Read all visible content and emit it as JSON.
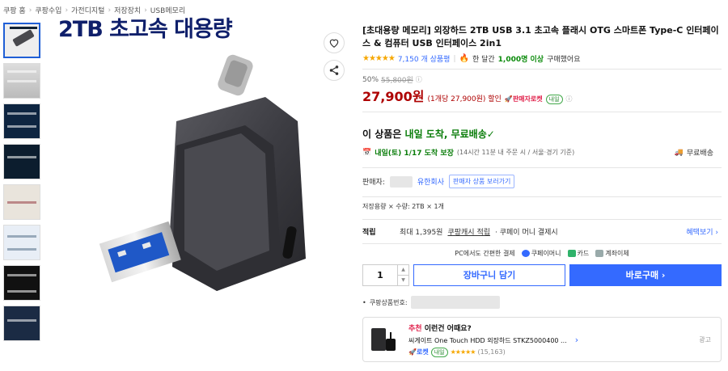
{
  "breadcrumb": [
    "쿠팡 홈",
    "쿠팡수입",
    "가전디지털",
    "저장장치",
    "USB메모리"
  ],
  "gallery": {
    "main_title": "2TB 초고속 대용량"
  },
  "product": {
    "title": "[초대용량 메모리] 외장하드 2TB USB 3.1 초고속 플래시 OTG 스마트폰 Type-C 인터페이스 & 컴퓨터 USB 인터페이스 2in1",
    "stars": "★★★★★",
    "review_count": "7,150 개 상품평",
    "buyers_prefix": "한 달간",
    "buyers_count": "1,000명 이상",
    "buyers_suffix": "구매했어요"
  },
  "price": {
    "discount_pct": "50%",
    "original_price": "55,800원",
    "sale_price": "27,900원",
    "unit_price": "(1개당 27,900원) 할인",
    "rocket_label": "판매자로켓",
    "rocket_tag": "내일"
  },
  "delivery": {
    "headline_prefix": "이 상품은",
    "headline_green": "내일 도착, 무료배송",
    "arrive_green": "내일(토) 1/17 도착 보장",
    "arrive_note": "(14시간 11분 내 주문 시 / 서울·경기 기준)",
    "shipping_label": "무료배송"
  },
  "seller": {
    "label": "판매자:",
    "name_suffix": "유한회사",
    "other_products_button": "판매자 상품 보러가기"
  },
  "option": {
    "text": "저장용량 × 수량: 2TB × 1개"
  },
  "points": {
    "label": "적립",
    "prefix": "최대 1,395원",
    "cash_link": "쿠팡캐시 적립",
    "suffix": "· 쿠페이 머니 결제시",
    "benefit_link": "혜택보기 ›"
  },
  "payment": {
    "intro": "PC에서도 간편한 결제",
    "methods": [
      "쿠페이머니",
      "카드",
      "계좌이체"
    ]
  },
  "purchase": {
    "quantity": "1",
    "cart_button": "장바구니 담기",
    "buy_button": "바로구매 ›"
  },
  "product_id_label": "쿠팡상품번호:",
  "recommendation": {
    "head_red": "추천",
    "head_rest": "이런건 어때요?",
    "product_name": "씨게이트 One Touch HDD 외장하드 STKZ5000400 ...",
    "rocket_tag": "로켓",
    "day_tag": "내일",
    "stars": "★★★★★",
    "reviews": "(15,163)",
    "ad_label": "광고"
  },
  "colors": {
    "accent_blue": "#346aff",
    "price_red": "#ae0000",
    "delivery_green": "#0a7d0a"
  }
}
